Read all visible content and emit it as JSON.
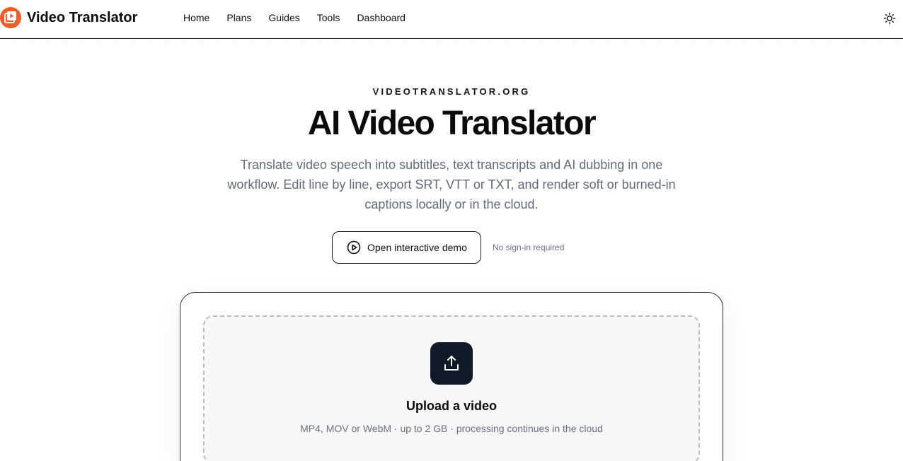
{
  "header": {
    "brand": "Video Translator",
    "nav": [
      {
        "label": "Home"
      },
      {
        "label": "Plans"
      },
      {
        "label": "Guides"
      },
      {
        "label": "Tools"
      },
      {
        "label": "Dashboard"
      }
    ],
    "theme_icon": "sun-icon",
    "logo_icon": "video-play-logo-icon"
  },
  "hero": {
    "kicker": "VIDEOTRANSLATOR.ORG",
    "title": "AI Video Translator",
    "subtitle": "Translate video speech into subtitles, text transcripts and AI dubbing in one workflow. Edit line by line, export SRT, VTT or TXT, and render soft or burned-in captions locally or in the cloud.",
    "demo_button": {
      "label": "Open interactive demo",
      "icon": "play-circle-icon"
    },
    "demo_note": "No sign-in required"
  },
  "upload": {
    "icon": "upload-icon",
    "title": "Upload a video",
    "subtitle": "MP4, MOV or WebM · up to 2 GB · processing continues in the cloud"
  },
  "colors": {
    "brand_accent": "#f25a28",
    "upload_icon_bg": "#111827",
    "muted_text": "#5f6b7e"
  }
}
